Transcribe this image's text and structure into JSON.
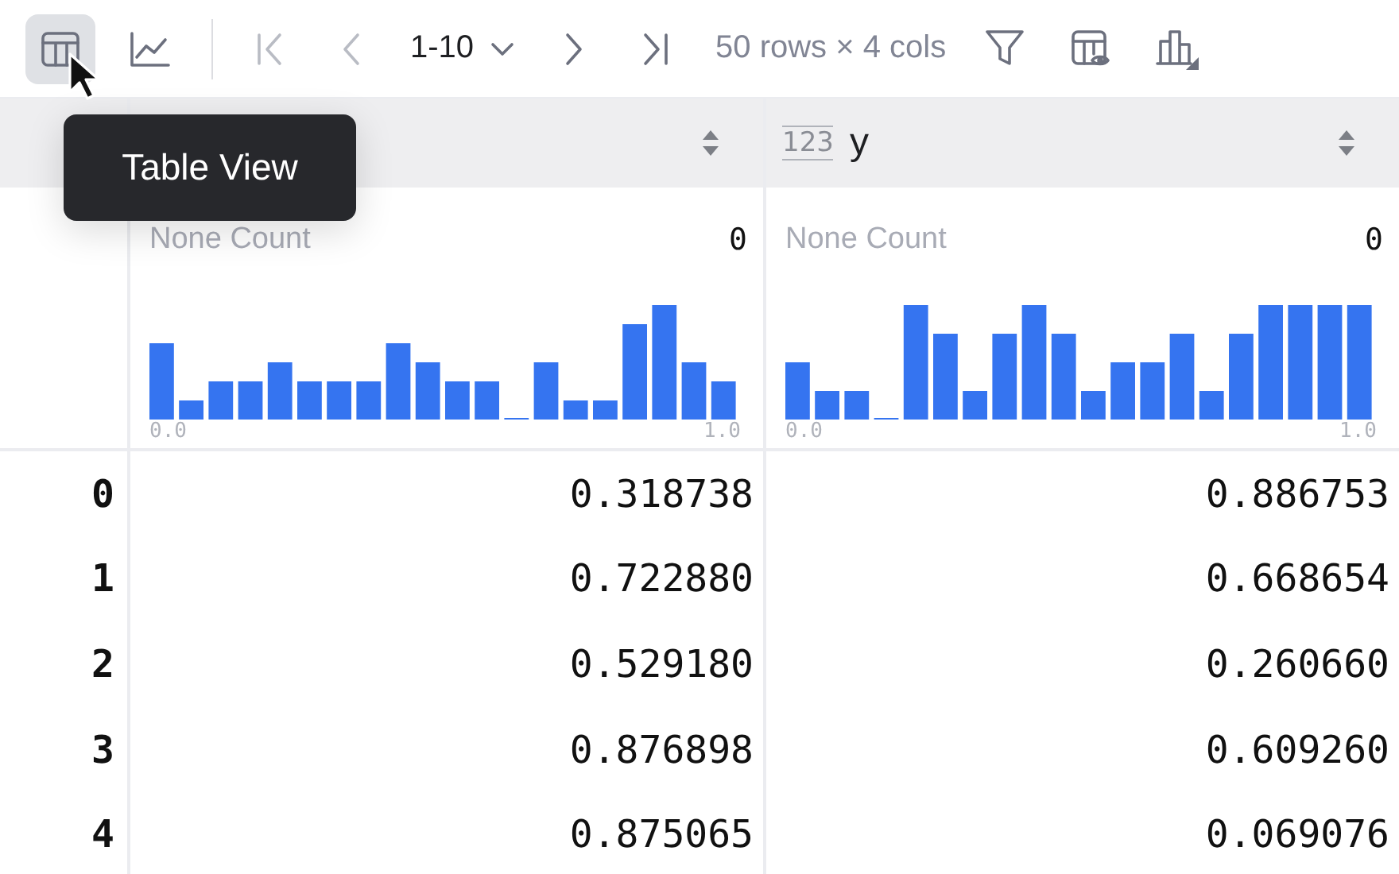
{
  "toolbar": {
    "view_buttons": [
      {
        "kind": "table",
        "selected": true
      },
      {
        "kind": "chart",
        "selected": false
      }
    ],
    "navigation": [
      {
        "kind": "first",
        "disabled": true
      },
      {
        "kind": "prev",
        "disabled": true
      },
      {
        "kind": "range",
        "label": "1-10"
      },
      {
        "kind": "next",
        "disabled": false
      },
      {
        "kind": "last",
        "disabled": false
      }
    ],
    "summary": "50 rows × 4 cols",
    "tools": [
      {
        "kind": "filter"
      },
      {
        "kind": "table-eye"
      },
      {
        "kind": "chart-bar"
      }
    ]
  },
  "tooltip": {
    "text": "Table View"
  },
  "columns": [
    {
      "none_label": "None Count",
      "none_count": "0",
      "axis_min": "0.0",
      "axis_max": "1.0"
    },
    {
      "type_label": "123",
      "name": "y",
      "none_label": "None Count",
      "none_count": "0",
      "axis_min": "0.0",
      "axis_max": "1.0"
    }
  ],
  "rows": [
    {
      "index": "0",
      "cells": [
        "0.318738",
        "0.886753"
      ]
    },
    {
      "index": "1",
      "cells": [
        "0.722880",
        "0.668654"
      ]
    },
    {
      "index": "2",
      "cells": [
        "0.529180",
        "0.260660"
      ]
    },
    {
      "index": "3",
      "cells": [
        "0.876898",
        "0.609260"
      ]
    },
    {
      "index": "4",
      "cells": [
        "0.875065",
        "0.069076"
      ]
    }
  ]
}
